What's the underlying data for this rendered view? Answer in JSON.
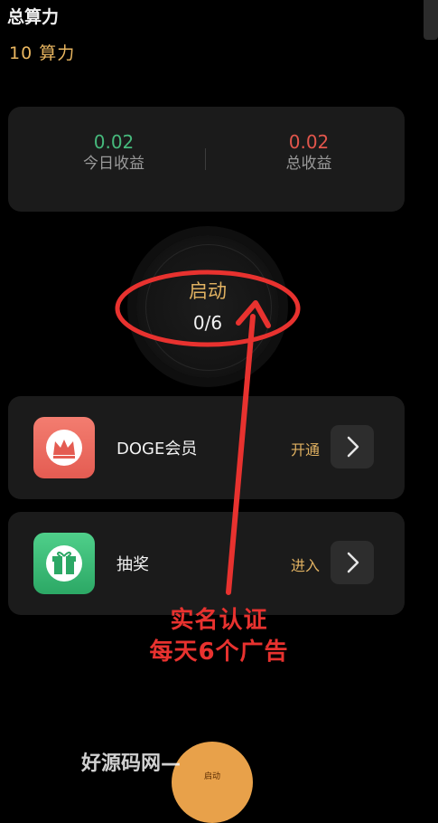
{
  "header": {
    "title": "总算力",
    "power_value": "10  算力"
  },
  "earnings": {
    "today_value": "0.02",
    "today_label": "今日收益",
    "total_value": "0.02",
    "total_label": "总收益",
    "today_color": "#46b97c",
    "total_color": "#e2564c"
  },
  "start": {
    "label": "启动",
    "count": "0/6"
  },
  "rows": [
    {
      "title": "DOGE会员",
      "action": "开通",
      "icon": "crown-icon"
    },
    {
      "title": "抽奖",
      "action": "进入",
      "icon": "gift-icon"
    }
  ],
  "annotation": {
    "line1": "实名认证",
    "line2": "每天6个广告",
    "color": "#e8322f"
  },
  "bottom": {
    "fab_label": "启动",
    "watermark": "好源码网—"
  },
  "colors": {
    "accent": "#e0b161",
    "card": "#1b1b1b",
    "background": "#000000"
  }
}
